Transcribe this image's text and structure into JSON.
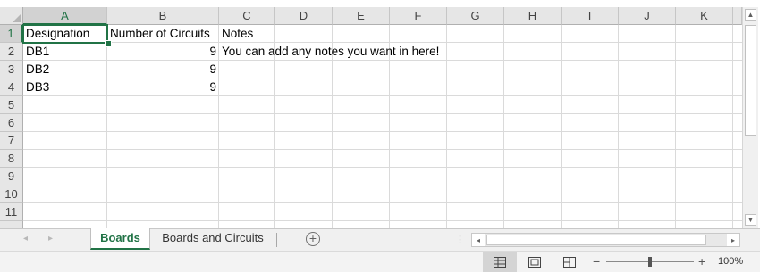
{
  "columns": [
    "A",
    "B",
    "C",
    "D",
    "E",
    "F",
    "G",
    "H",
    "I",
    "J",
    "K"
  ],
  "rows": [
    "1",
    "2",
    "3",
    "4",
    "5",
    "6",
    "7",
    "8",
    "9",
    "10",
    "11"
  ],
  "cells": {
    "a1": "Designation",
    "b1": "Number of Circuits",
    "c1": "Notes",
    "a2": "DB1",
    "b2": "9",
    "c2": "You can add any notes you want in here!",
    "a3": "DB2",
    "b3": "9",
    "a4": "DB3",
    "b4": "9"
  },
  "sheet_tabs": [
    "Boards",
    "Boards and Circuits"
  ],
  "active_tab": "Boards",
  "add_sheet_symbol": "+",
  "status": {
    "zoom": "100%",
    "zoom_minus": "−",
    "zoom_plus": "+"
  },
  "icons": {
    "nav_left": "◂",
    "nav_right": "▸",
    "scroll_up": "▲",
    "scroll_down": "▼",
    "scroll_left": "◂",
    "scroll_right": "▸",
    "split": "⋮"
  },
  "colors": {
    "accent": "#217346"
  }
}
